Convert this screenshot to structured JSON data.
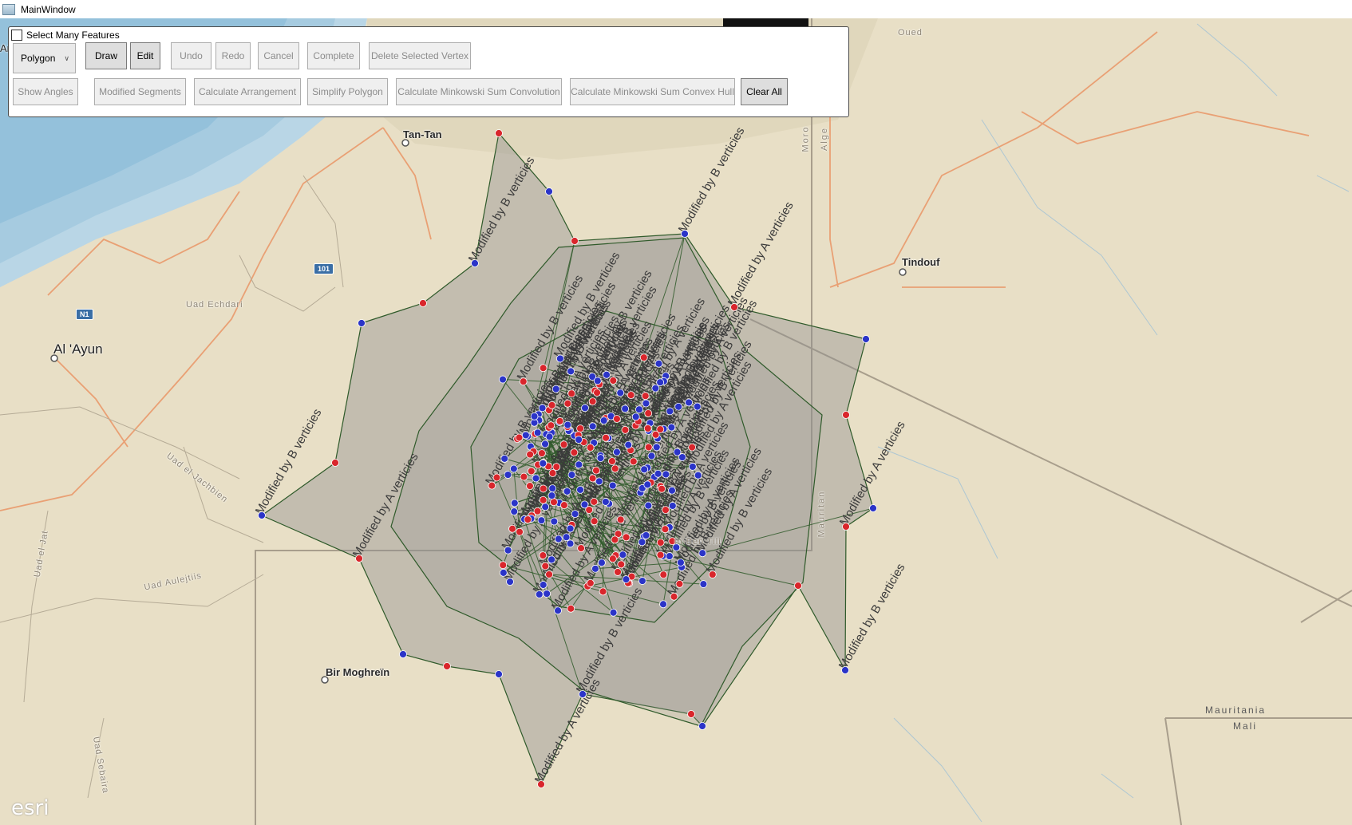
{
  "window": {
    "title": "MainWindow"
  },
  "toolbar": {
    "select_many_label": "Select Many Features",
    "geometry_type": "Polygon",
    "row1": [
      {
        "id": "draw",
        "label": "Draw",
        "enabled": true
      },
      {
        "id": "edit",
        "label": "Edit",
        "enabled": true
      },
      {
        "id": "undo",
        "label": "Undo",
        "enabled": false
      },
      {
        "id": "redo",
        "label": "Redo",
        "enabled": false
      },
      {
        "id": "cancel",
        "label": "Cancel",
        "enabled": false
      },
      {
        "id": "complete",
        "label": "Complete",
        "enabled": false
      },
      {
        "id": "delete-vertex",
        "label": "Delete Selected Vertex",
        "enabled": false
      }
    ],
    "row2": [
      {
        "id": "show-angles",
        "label": "Show Angles",
        "enabled": false
      },
      {
        "id": "modified-segments",
        "label": "Modified Segments",
        "enabled": false
      },
      {
        "id": "calc-arrangement",
        "label": "Calculate Arrangement",
        "enabled": false
      },
      {
        "id": "simplify",
        "label": "Simplify Polygon",
        "enabled": false
      },
      {
        "id": "mink-conv",
        "label": "Calculate Minkowski Sum Convolution",
        "enabled": false
      },
      {
        "id": "mink-hull",
        "label": "Calculate Minkowski Sum Convex Hull",
        "enabled": false
      },
      {
        "id": "clear-all",
        "label": "Clear All",
        "enabled": true
      }
    ]
  },
  "map": {
    "places": {
      "al_ayun": "Al 'Ayun",
      "tan_tan": "Tan-Tan",
      "tindouf": "Tindouf",
      "bir_moghrein": "Bir Moghreïn",
      "mauritania": "Mauritania",
      "mali": "Mali",
      "uad_echdari": "Uad Echdari",
      "uad_el_jachbien": "Uad el Jachbien",
      "uad_aulejtiis": "Uad Aulejtiis",
      "uad_el_jat": "Uad el Jat",
      "uad_sebaira": "Uad Sebaira",
      "algeria_fragment": "Alge",
      "morocco_fragment": "Moro",
      "mauritania_fragment": "Mauritan",
      "ain_ben_tili": "in Ben Tili",
      "ar": "Ar",
      "oued": "Oued"
    },
    "shields": {
      "n1": "N1",
      "r101": "101"
    },
    "attribution": "esri",
    "annotations": {
      "a_label": "Modified by A verticies",
      "b_label": "Modified by B verticies"
    },
    "colors": {
      "polygon_fill": "#8f8f8f",
      "polygon_stroke": "#2f5a2a",
      "vertex_a": "#d9262c",
      "vertex_b": "#2b34c8",
      "road": "#e9a074",
      "border": "#a89e8c",
      "water": "#a8c9df"
    }
  },
  "overlay_tools": [
    "edit-tools-icon",
    "select-pointer-icon",
    "fit-frame-icon",
    "measure-screen-icon"
  ]
}
